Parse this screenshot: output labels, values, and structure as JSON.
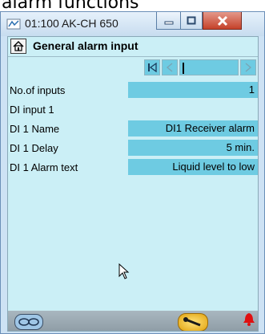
{
  "caption": "alarm functions",
  "window": {
    "title": "01:100 AK-CH 650",
    "minimize_symbol": "—",
    "maximize_symbol": "□",
    "close_symbol": "X"
  },
  "page": {
    "title": "General alarm input",
    "home_icon": "home-icon"
  },
  "navigation": {
    "first_icon": "first-page-icon",
    "prev_icon": "previous-icon",
    "next_icon": "next-icon"
  },
  "rows": [
    {
      "label": "No.of inputs",
      "value": "1"
    },
    {
      "label": "DI input 1",
      "value": ""
    },
    {
      "label": "DI 1 Name",
      "value": "DI1 Receiver alarm"
    },
    {
      "label": "DI 1 Delay",
      "value": "5 min."
    },
    {
      "label": "DI 1 Alarm text",
      "value": "Liquid level to low"
    }
  ],
  "footer": {
    "left_icon": "glasses-icon",
    "key_icon": "key-icon",
    "alarm_icon": "alarm-bell-icon",
    "alarm_color": "#e01010"
  },
  "colors": {
    "content_bg": "#cbeff6",
    "field_bg": "#6ecbe2"
  }
}
